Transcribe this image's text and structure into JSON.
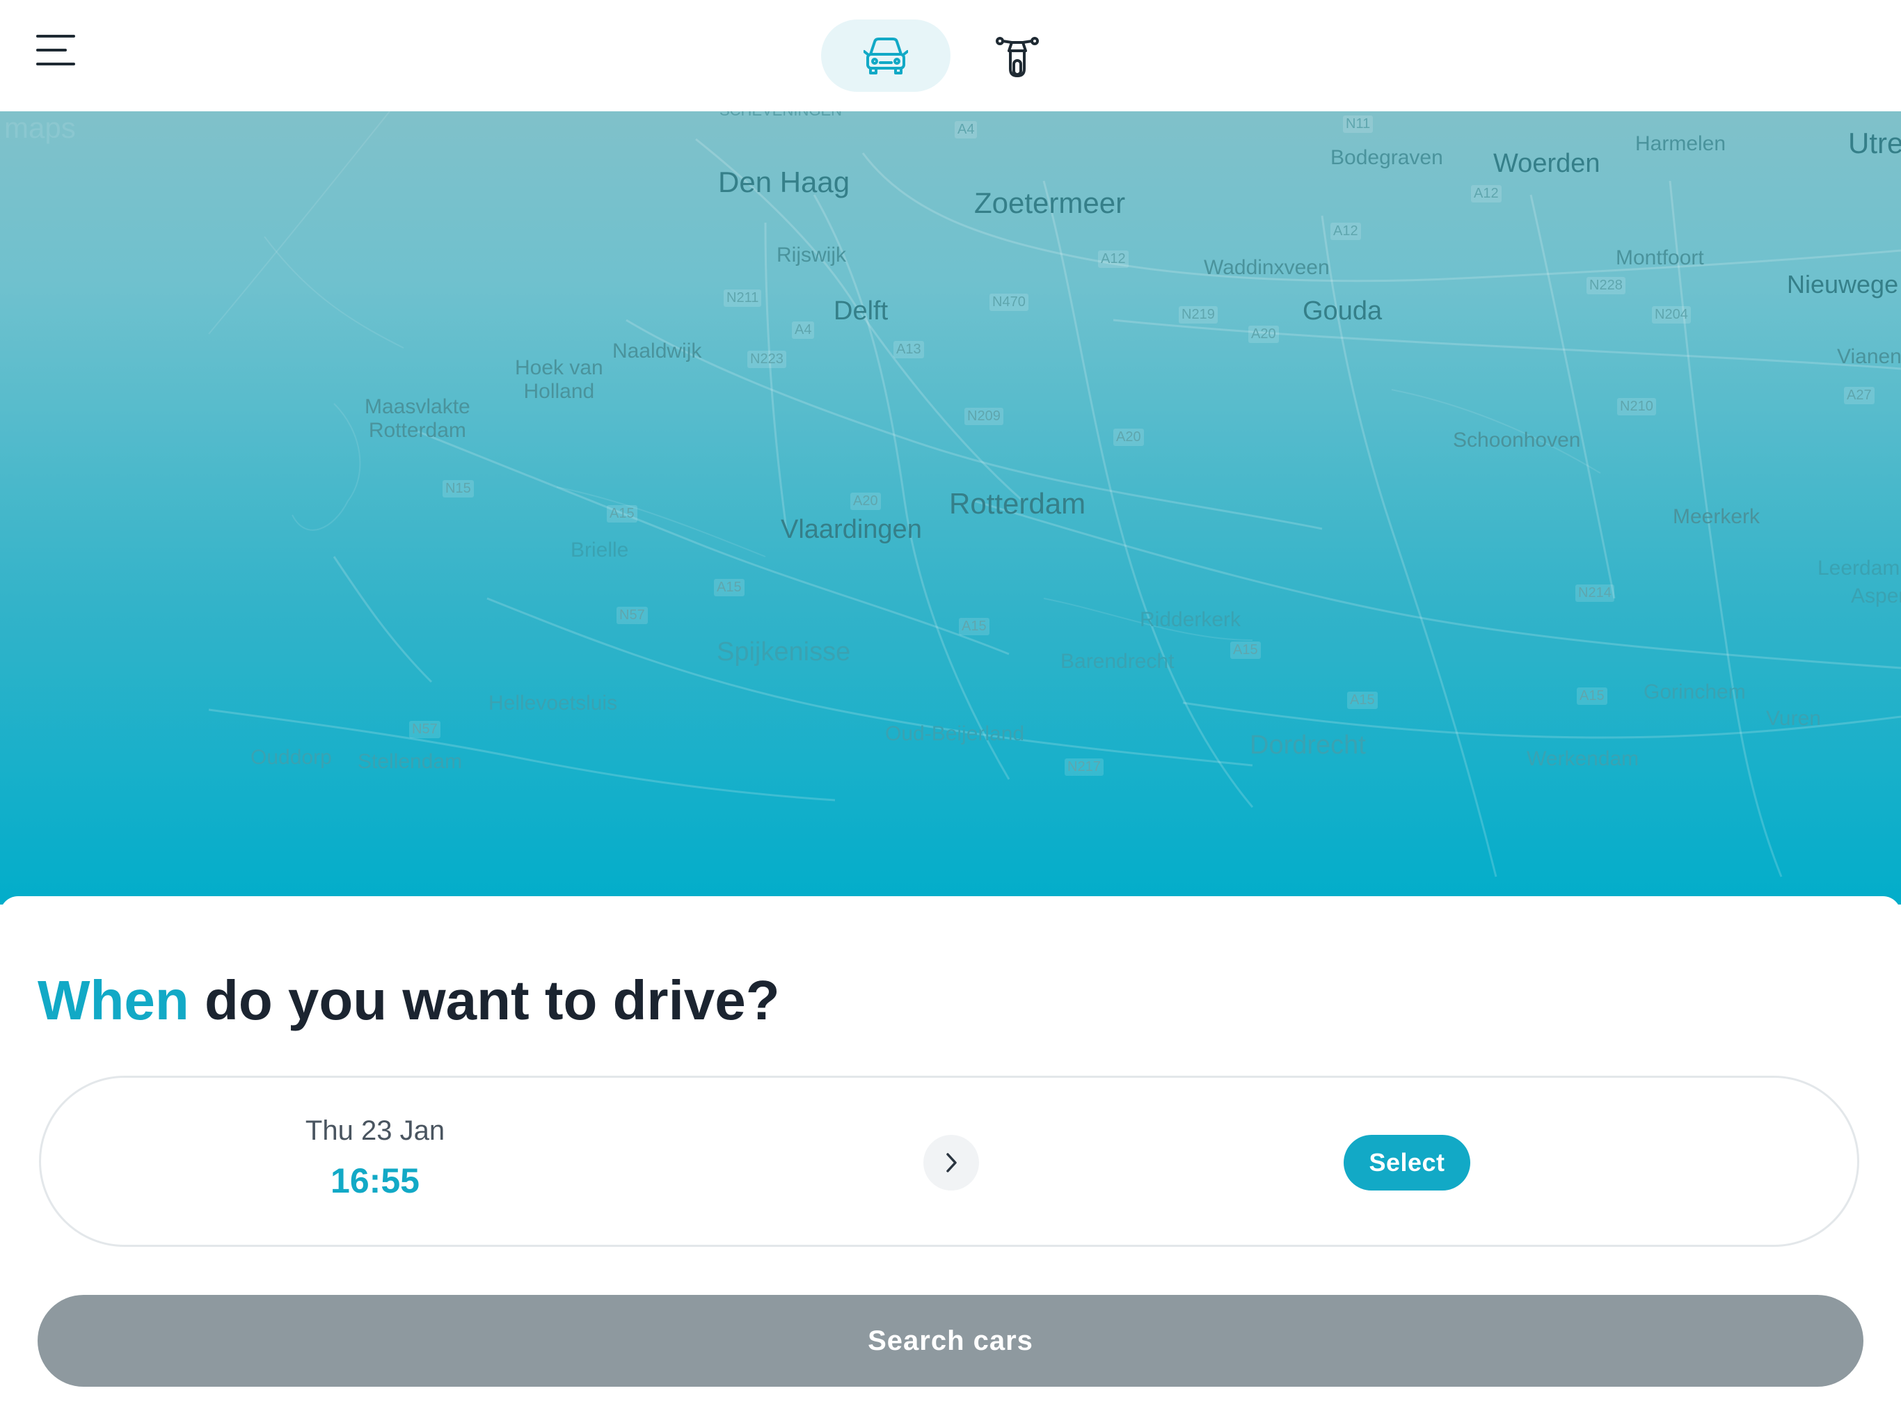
{
  "header": {
    "menu_icon": "hamburger-menu-icon",
    "modes": [
      {
        "name": "car",
        "icon": "car-icon",
        "active": true
      },
      {
        "name": "scooter",
        "icon": "scooter-icon",
        "active": false
      }
    ]
  },
  "map": {
    "watermark": "maps",
    "places": {
      "scheveningen": "SCHEVENINGEN",
      "den_haag": "Den Haag",
      "zoetermeer": "Zoetermeer",
      "bodegraven": "Bodegraven",
      "woerden": "Woerden",
      "harmelen": "Harmelen",
      "utrecht": "Utre",
      "rijswijk": "Rijswijk",
      "waddinxveen": "Waddinxveen",
      "montfoort": "Montfoort",
      "nieuwegein": "Nieuwege",
      "delft": "Delft",
      "gouda": "Gouda",
      "naaldwijk": "Naaldwijk",
      "hoek_van_holland": "Hoek van\nHolland",
      "maasvlakte": "Maasvlakte\nRotterdam",
      "vianen": "Vianen",
      "schoonhoven": "Schoonhoven",
      "rotterdam": "Rotterdam",
      "vlaardingen": "Vlaardingen",
      "meerkerk": "Meerkerk",
      "brielle": "Brielle",
      "leerdam": "Leerdam",
      "asperen": "Asper",
      "ridderkerk": "Ridderkerk",
      "spijkenisse": "Spijkenisse",
      "barendrecht": "Barendrecht",
      "gorinchem": "Gorinchem",
      "hellevoetsluis": "Hellevoetsluis",
      "vuren": "Vuren",
      "oud_beijerland": "Oud-Beijerland",
      "dordrecht": "Dordrecht",
      "ouddorp": "Ouddorp",
      "stellendam": "Stellendam",
      "werkendam": "Werkendam"
    },
    "roads": {
      "a4_top": "A4",
      "n11": "N11",
      "a12_a": "A12",
      "a12_b": "A12",
      "a12_c": "A12",
      "n211": "N211",
      "n470": "N470",
      "n219": "N219",
      "a20_a": "A20",
      "n228": "N228",
      "n204": "N204",
      "a4_b": "A4",
      "a13": "A13",
      "n223": "N223",
      "a27": "A27",
      "n209": "N209",
      "a20_b": "A20",
      "n210": "N210",
      "n15": "N15",
      "a20_c": "A20",
      "a15_a": "A15",
      "a15_b": "A15",
      "n214": "N214",
      "n57_a": "N57",
      "a15_c": "A15",
      "a15_d": "A15",
      "a15_e": "A15",
      "a15_f": "A15",
      "n57_b": "N57",
      "n217": "N217"
    }
  },
  "sheet": {
    "title_accent": "When",
    "title_rest": " do you want to drive?",
    "start": {
      "date": "Thu 23 Jan",
      "time": "16:55"
    },
    "next_icon": "chevron-right-icon",
    "end_label": "Select",
    "search_label": "Search cars"
  },
  "colors": {
    "accent": "#12a9c6",
    "search_disabled": "#8e999f",
    "title": "#1b2430"
  }
}
